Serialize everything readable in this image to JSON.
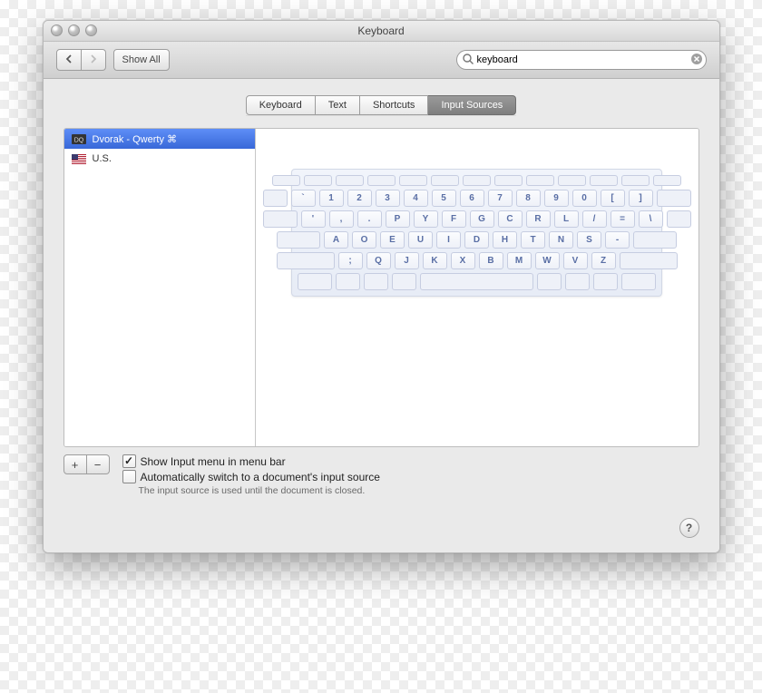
{
  "window": {
    "title": "Keyboard"
  },
  "toolbar": {
    "show_all": "Show All",
    "search_value": "keyboard"
  },
  "tabs": [
    {
      "label": "Keyboard",
      "selected": false
    },
    {
      "label": "Text",
      "selected": false
    },
    {
      "label": "Shortcuts",
      "selected": false
    },
    {
      "label": "Input Sources",
      "selected": true
    }
  ],
  "sources": [
    {
      "icon": "dq",
      "label": "Dvorak - Qwerty ⌘",
      "selected": true
    },
    {
      "icon": "us",
      "label": "U.S.",
      "selected": false
    }
  ],
  "keyboard_rows": [
    [
      "`",
      "1",
      "2",
      "3",
      "4",
      "5",
      "6",
      "7",
      "8",
      "9",
      "0",
      "[",
      "]"
    ],
    [
      "'",
      ",",
      ".",
      "P",
      "Y",
      "F",
      "G",
      "C",
      "R",
      "L",
      "/",
      "=",
      "\\"
    ],
    [
      "A",
      "O",
      "E",
      "U",
      "I",
      "D",
      "H",
      "T",
      "N",
      "S",
      "-"
    ],
    [
      ";",
      "Q",
      "J",
      "K",
      "X",
      "B",
      "M",
      "W",
      "V",
      "Z"
    ]
  ],
  "options": {
    "show_input_menu": {
      "label": "Show Input menu in menu bar",
      "checked": true
    },
    "auto_switch": {
      "label": "Automatically switch to a document's input source",
      "checked": false
    },
    "hint": "The input source is used until the document is closed."
  },
  "help_label": "?"
}
